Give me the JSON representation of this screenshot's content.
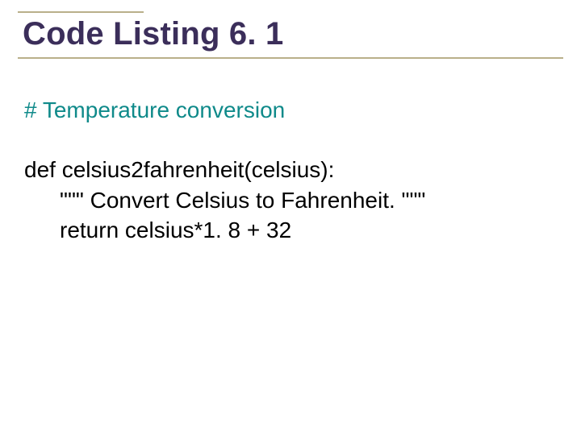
{
  "title": "Code Listing 6. 1",
  "comment": "# Temperature conversion",
  "code": {
    "line1": "def celsius2fahrenheit(celsius):",
    "line2": "\"\"\" Convert Celsius to Fahrenheit. \"\"\"",
    "line3": "return celsius*1. 8 + 32"
  }
}
